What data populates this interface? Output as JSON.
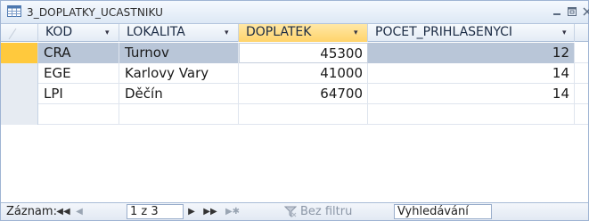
{
  "window": {
    "title": "3_DOPLATKY_UCASTNIKU"
  },
  "columns": [
    {
      "label": "KOD",
      "arrow": "▾"
    },
    {
      "label": "LOKALITA",
      "arrow": "▾"
    },
    {
      "label": "DOPLATEK",
      "arrow": "▾"
    },
    {
      "label": "POCET_PRIHLASENYCI",
      "arrow": "▾"
    }
  ],
  "rows": [
    {
      "kod": "CRA",
      "lokalita": "Turnov",
      "doplatek": "45300",
      "pocet": "12"
    },
    {
      "kod": "EGE",
      "lokalita": "Karlovy Vary",
      "doplatek": "41000",
      "pocet": "14"
    },
    {
      "kod": "LPI",
      "lokalita": "Děčín",
      "doplatek": "64700",
      "pocet": "14"
    }
  ],
  "status": {
    "record_label": "Záznam:",
    "nav_first": "◀◀",
    "nav_prev": "◀",
    "record_value": "1 z 3",
    "nav_next": "▶",
    "nav_last": "▶▶",
    "nav_new": "▶✱",
    "filter_label": "Bez filtru",
    "search_value": "Vyhledávání"
  },
  "colors": {
    "selected_header": "#ffd46a",
    "selected_row_selector": "#ffc93d",
    "selected_row": "#b9c6d8"
  }
}
